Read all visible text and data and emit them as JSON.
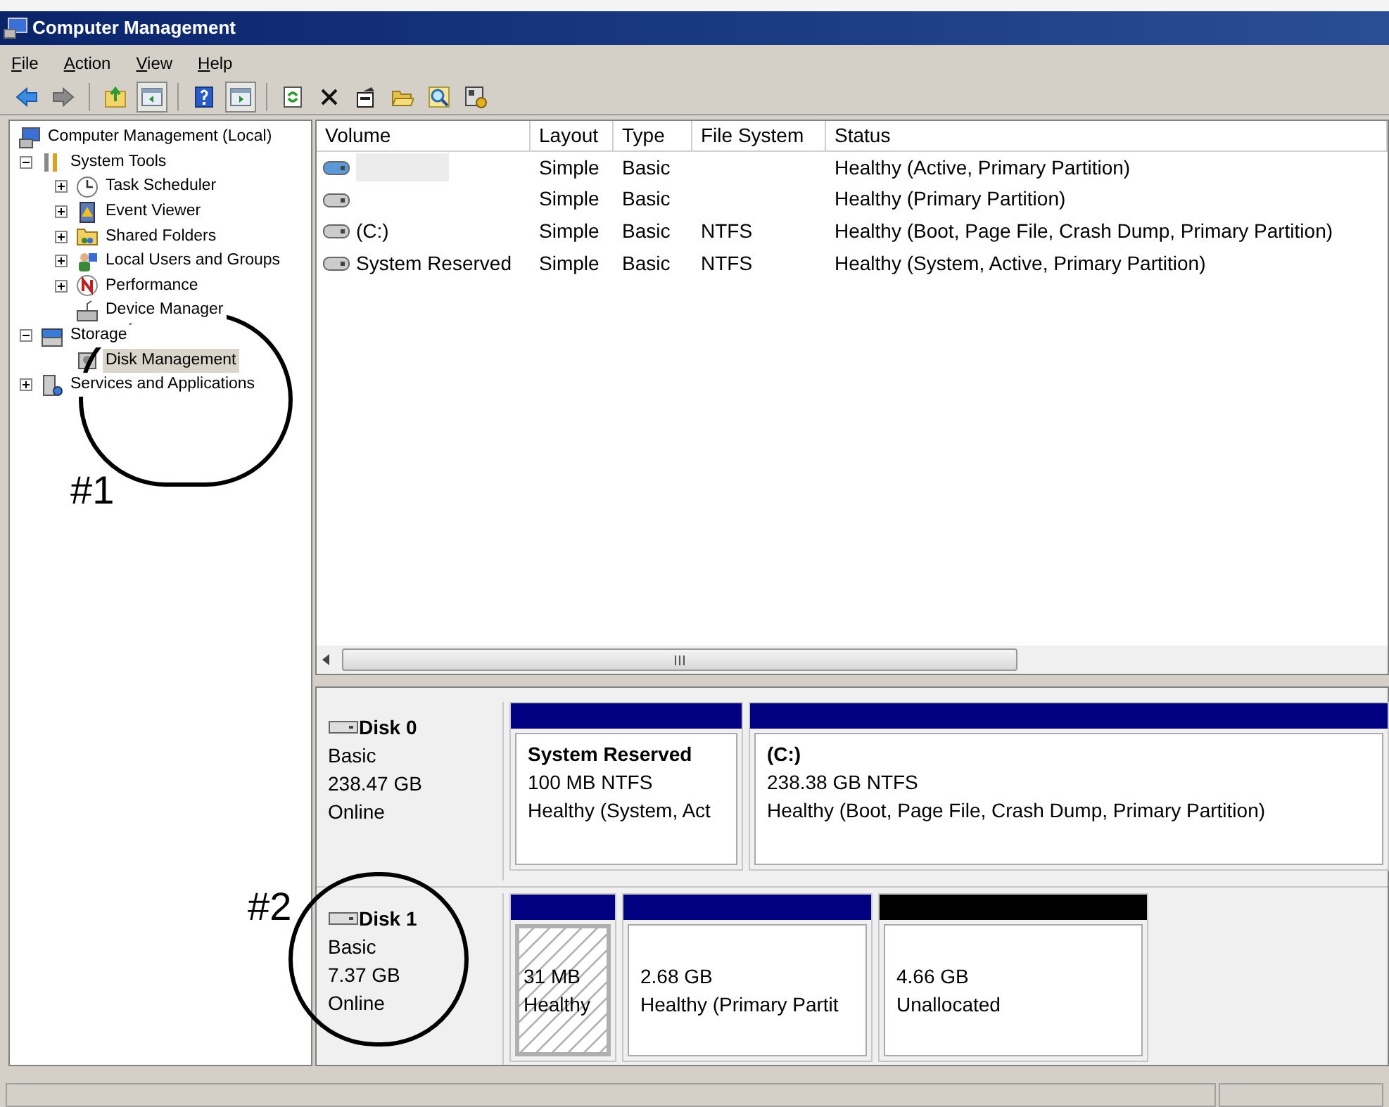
{
  "window": {
    "title": "Computer Management"
  },
  "menu": [
    "File",
    "Action",
    "View",
    "Help"
  ],
  "toolbar": [
    {
      "kind": "button",
      "pressed": false
    },
    {
      "kind": "button",
      "pressed": false
    },
    {
      "kind": "separator"
    },
    {
      "kind": "button",
      "pressed": false
    },
    {
      "kind": "button",
      "pressed": true
    },
    {
      "kind": "separator"
    },
    {
      "kind": "button",
      "pressed": false
    },
    {
      "kind": "button",
      "pressed": true
    },
    {
      "kind": "separator"
    },
    {
      "kind": "button",
      "pressed": false
    },
    {
      "kind": "button",
      "pressed": false
    },
    {
      "kind": "button",
      "pressed": false
    },
    {
      "kind": "button",
      "pressed": false
    },
    {
      "kind": "button",
      "pressed": false
    },
    {
      "kind": "button",
      "pressed": false
    }
  ],
  "tree": [
    {
      "label": "Computer Management (Local)",
      "selected": false,
      "children": [
        {
          "label": "System Tools",
          "expanded": true,
          "selected": false,
          "children": [
            {
              "label": "Task Scheduler",
              "expanded": false,
              "selected": false
            },
            {
              "label": "Event Viewer",
              "expanded": false,
              "selected": false
            },
            {
              "label": "Shared Folders",
              "expanded": false,
              "selected": false
            },
            {
              "label": "Local Users and Groups",
              "expanded": false,
              "selected": false
            },
            {
              "label": "Performance",
              "expanded": false,
              "selected": false
            },
            {
              "label": "Device Manager",
              "selected": false
            }
          ]
        },
        {
          "label": "Storage",
          "expanded": true,
          "selected": false,
          "children": [
            {
              "label": "Disk Management",
              "selected": true
            }
          ]
        },
        {
          "label": "Services and Applications",
          "expanded": false,
          "selected": false
        }
      ]
    }
  ],
  "volumes": {
    "columns": [
      "Volume",
      "Layout",
      "Type",
      "File System",
      "Status"
    ],
    "rows": [
      {
        "selected": true,
        "cells": [
          "",
          "Simple",
          "Basic",
          "",
          "Healthy (Active, Primary Partition)"
        ]
      },
      {
        "selected": false,
        "cells": [
          "",
          "Simple",
          "Basic",
          "",
          "Healthy (Primary Partition)"
        ]
      },
      {
        "selected": false,
        "cells": [
          "(C:)",
          "Simple",
          "Basic",
          "NTFS",
          "Healthy (Boot, Page File, Crash Dump, Primary Partition)"
        ]
      },
      {
        "selected": false,
        "cells": [
          "System Reserved",
          "Simple",
          "Basic",
          "NTFS",
          "Healthy (System, Active, Primary Partition)"
        ]
      }
    ]
  },
  "disks": [
    {
      "name": "Disk 0",
      "lines": [
        "Basic",
        "238.47 GB",
        "Online"
      ],
      "partitions": [
        {
          "kind": "primary",
          "selected": false,
          "title": "System Reserved",
          "lines": [
            "100 MB NTFS",
            "Healthy (System, Act"
          ]
        },
        {
          "kind": "primary",
          "selected": false,
          "title": "(C:)",
          "lines": [
            "238.38 GB NTFS",
            "Healthy (Boot, Page File, Crash Dump, Primary Partition)"
          ]
        }
      ]
    },
    {
      "name": "Disk 1",
      "lines": [
        "Basic",
        "7.37 GB",
        "Online"
      ],
      "partitions": [
        {
          "kind": "primary",
          "selected": true,
          "lines": [
            "31 MB",
            "Healthy"
          ]
        },
        {
          "kind": "primary",
          "selected": false,
          "lines": [
            "2.68 GB",
            "Healthy (Primary Partit"
          ]
        },
        {
          "kind": "unallocated",
          "selected": false,
          "lines": [
            "4.66 GB",
            "Unallocated"
          ]
        }
      ]
    }
  ],
  "annotations": [
    {
      "label": "#1"
    },
    {
      "label": "#2"
    }
  ]
}
